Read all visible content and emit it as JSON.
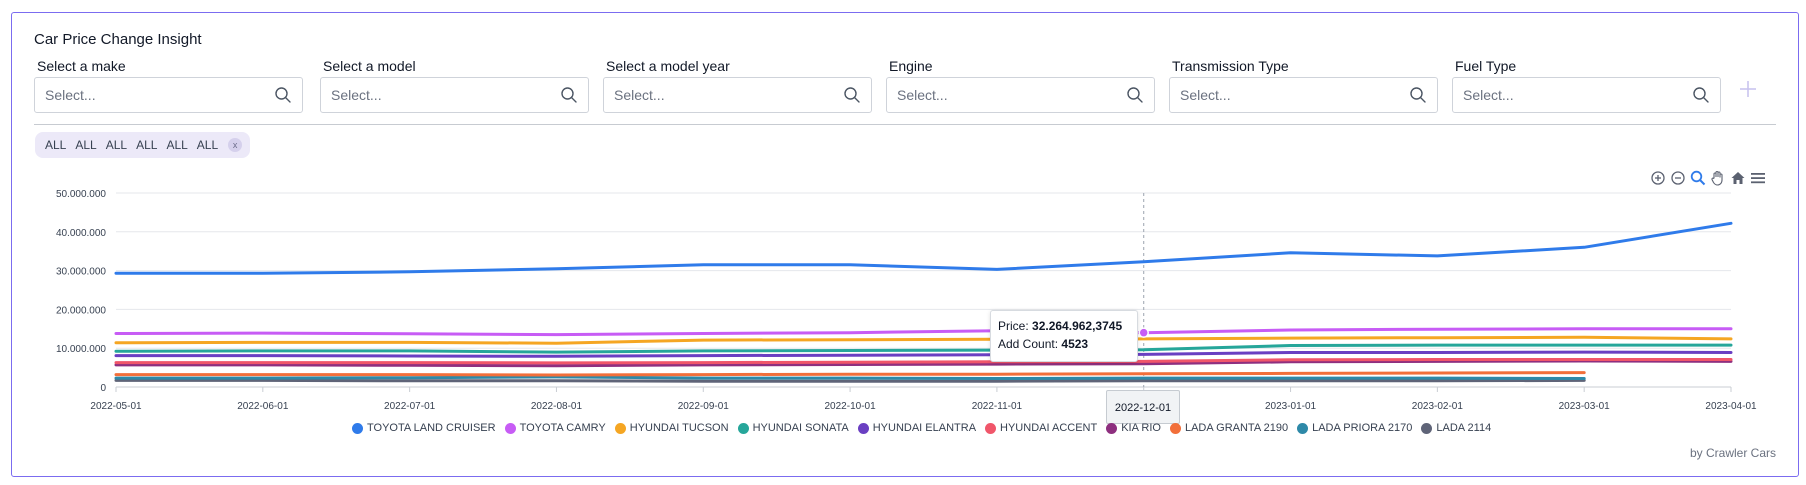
{
  "title": "Car Price Change Insight",
  "filters": [
    {
      "label": "Select a make",
      "placeholder": "Select..."
    },
    {
      "label": "Select a model",
      "placeholder": "Select..."
    },
    {
      "label": "Select a model year",
      "placeholder": "Select..."
    },
    {
      "label": "Engine",
      "placeholder": "Select..."
    },
    {
      "label": "Transmission Type",
      "placeholder": "Select..."
    },
    {
      "label": "Fuel Type",
      "placeholder": "Select..."
    }
  ],
  "chips": [
    "ALL",
    "ALL",
    "ALL",
    "ALL",
    "ALL",
    "ALL"
  ],
  "chip_close": "x",
  "credit": "by Crawler Cars",
  "tooltip": {
    "price_label": "Price:",
    "price_value": "32.264.962,3745",
    "count_label": "Add Count:",
    "count_value": "4523"
  },
  "crosshair_label": "2022-12-01",
  "toolbar_icons": [
    "zoom-in-icon",
    "zoom-out-icon",
    "magnify-icon",
    "pan-hand-icon",
    "home-icon",
    "menu-icon"
  ],
  "colors": {
    "accent": "#7b6cf0",
    "grid": "#e5e7eb"
  },
  "chart_data": {
    "type": "line",
    "title": "",
    "xlabel": "",
    "ylabel": "",
    "ylim": [
      0,
      50000000
    ],
    "y_ticks": [
      "0",
      "10.000.000",
      "20.000.000",
      "30.000.000",
      "40.000.000",
      "50.000.000"
    ],
    "y_tick_values": [
      0,
      10000000,
      20000000,
      30000000,
      40000000,
      50000000
    ],
    "grid": true,
    "legend": "bottom",
    "categories": [
      "2022-05-01",
      "2022-06-01",
      "2022-07-01",
      "2022-08-01",
      "2022-09-01",
      "2022-10-01",
      "2022-11-01",
      "2022-12-01",
      "2023-01-01",
      "2023-02-01",
      "2023-03-01",
      "2023-04-01"
    ],
    "series": [
      {
        "name": "TOYOTA LAND CRUISER",
        "color": "#2f7bea",
        "values": [
          29300000,
          29300000,
          29700000,
          30500000,
          31500000,
          31500000,
          30300000,
          32264962,
          34600000,
          33800000,
          36000000,
          42200000
        ]
      },
      {
        "name": "TOYOTA CAMRY",
        "color": "#c75cf5",
        "values": [
          13800000,
          13900000,
          13700000,
          13500000,
          13800000,
          14000000,
          14500000,
          14000000,
          14700000,
          14900000,
          15000000,
          15000000
        ]
      },
      {
        "name": "HYUNDAI TUCSON",
        "color": "#f5a623",
        "values": [
          11400000,
          11500000,
          11500000,
          11300000,
          12100000,
          12200000,
          12300000,
          12400000,
          12600000,
          12700000,
          12800000,
          12400000
        ]
      },
      {
        "name": "HYUNDAI SONATA",
        "color": "#26a69a",
        "values": [
          9200000,
          9300000,
          9300000,
          9000000,
          9300000,
          9400000,
          9500000,
          9600000,
          10700000,
          10800000,
          10800000,
          10800000
        ]
      },
      {
        "name": "HYUNDAI ELANTRA",
        "color": "#6a3fc2",
        "values": [
          8100000,
          8100000,
          8000000,
          7900000,
          8100000,
          8200000,
          8300000,
          8400000,
          8900000,
          8900000,
          9000000,
          8900000
        ]
      },
      {
        "name": "HYUNDAI ACCENT",
        "color": "#f0566a",
        "values": [
          6300000,
          6300000,
          6300000,
          6200000,
          6300000,
          6400000,
          6500000,
          6600000,
          7000000,
          7100000,
          7100000,
          7100000
        ]
      },
      {
        "name": "KIA RIO",
        "color": "#8e2f7f",
        "values": [
          5700000,
          5700000,
          5600000,
          5500000,
          5700000,
          5800000,
          5900000,
          6000000,
          6500000,
          6600000,
          6700000,
          6600000
        ]
      },
      {
        "name": "LADA GRANTA 2190",
        "color": "#f26f3a",
        "values": [
          3200000,
          3200000,
          3200000,
          3100000,
          3200000,
          3300000,
          3300000,
          3400000,
          3500000,
          3600000,
          3700000,
          null
        ]
      },
      {
        "name": "LADA PRIORA 2170",
        "color": "#2e89a8",
        "values": [
          2300000,
          2300000,
          2400000,
          2600000,
          2300000,
          2300000,
          2200000,
          2300000,
          2300000,
          2300000,
          2200000,
          null
        ]
      },
      {
        "name": "LADA 2114",
        "color": "#5f6478",
        "values": [
          1700000,
          1700000,
          1600000,
          1600000,
          1500000,
          1500000,
          1500000,
          1600000,
          1600000,
          1600000,
          1700000,
          null
        ]
      }
    ],
    "highlight": {
      "category": "2022-12-01",
      "series": "TOYOTA CAMRY"
    }
  }
}
